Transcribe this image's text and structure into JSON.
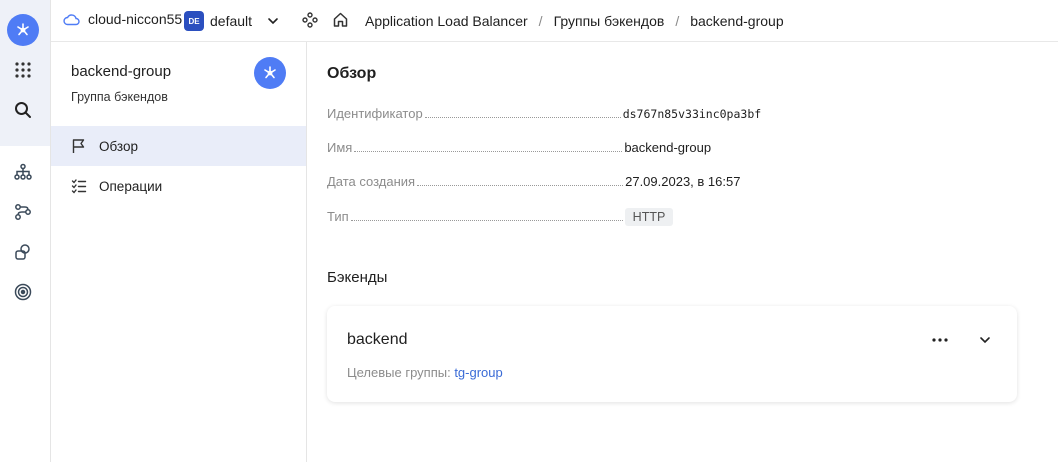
{
  "header": {
    "cloud_name": "cloud-niccon55",
    "folder_badge": "DE",
    "folder_name": "default",
    "breadcrumbs": [
      "Application Load Balancer",
      "Группы бэкендов",
      "backend-group"
    ]
  },
  "rail": {
    "icons": [
      "alb-logo-icon",
      "apps-grid-icon",
      "search-icon",
      "hierarchy-icon",
      "routes-icon",
      "shapes-icon",
      "target-icon"
    ]
  },
  "sidebar": {
    "title": "backend-group",
    "subtitle": "Группа бэкендов",
    "items": [
      {
        "label": "Обзор",
        "icon": "flag-icon",
        "active": true
      },
      {
        "label": "Операции",
        "icon": "checklist-icon",
        "active": false
      }
    ]
  },
  "overview": {
    "title": "Обзор",
    "props": [
      {
        "label": "Идентификатор",
        "value": "ds767n85v33inc0pa3bf"
      },
      {
        "label": "Имя",
        "value": "backend-group"
      },
      {
        "label": "Дата создания",
        "value": "27.09.2023, в 16:57"
      },
      {
        "label": "Тип",
        "value": "HTTP"
      }
    ]
  },
  "backends": {
    "title": "Бэкенды",
    "card": {
      "name": "backend",
      "target_label": "Целевые группы:",
      "target_link": "tg-group"
    }
  },
  "colors": {
    "accent": "#4f7cf5",
    "link": "#3a6bd6",
    "active_bg": "#e9edf9"
  }
}
